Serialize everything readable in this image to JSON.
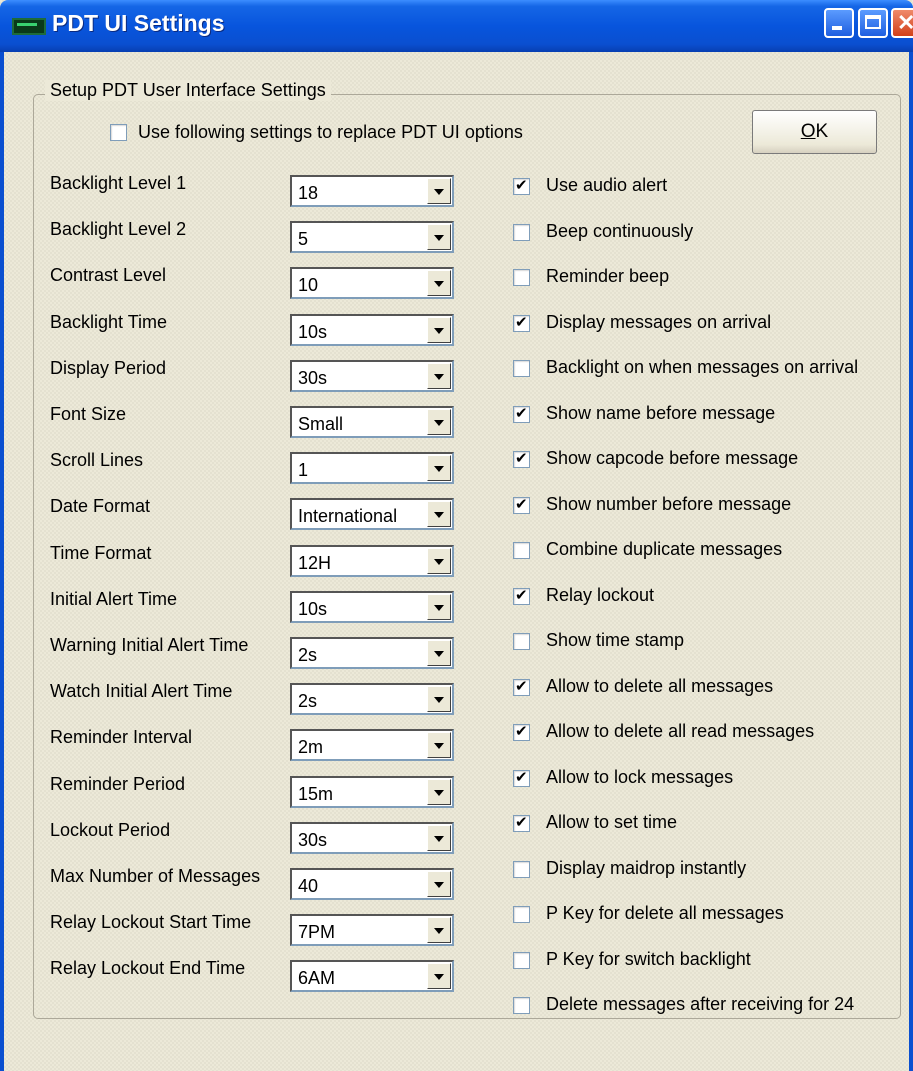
{
  "window": {
    "title": "PDT UI Settings",
    "icon": "pager-icon"
  },
  "group": {
    "label": "Setup PDT User Interface Settings",
    "replace_option": {
      "label": "Use following settings to replace PDT UI options",
      "checked": false
    },
    "ok_button": {
      "label_underlined": "O",
      "label_rest": "K"
    }
  },
  "settings": [
    {
      "label": "Backlight Level 1",
      "value": "18"
    },
    {
      "label": "Backlight Level 2",
      "value": "5"
    },
    {
      "label": "Contrast Level",
      "value": "10"
    },
    {
      "label": "Backlight Time",
      "value": "10s"
    },
    {
      "label": "Display Period",
      "value": "30s"
    },
    {
      "label": "Font Size",
      "value": "Small"
    },
    {
      "label": "Scroll Lines",
      "value": "1"
    },
    {
      "label": "Date Format",
      "value": "International"
    },
    {
      "label": "Time Format",
      "value": "12H"
    },
    {
      "label": "Initial Alert Time",
      "value": "10s"
    },
    {
      "label": "Warning Initial Alert Time",
      "value": "2s"
    },
    {
      "label": "Watch Initial Alert Time",
      "value": "2s"
    },
    {
      "label": "Reminder Interval",
      "value": "2m"
    },
    {
      "label": "Reminder Period",
      "value": "15m"
    },
    {
      "label": "Lockout Period",
      "value": "30s"
    },
    {
      "label": "Max Number of Messages",
      "value": "40"
    },
    {
      "label": "Relay Lockout Start Time",
      "value": "7PM"
    },
    {
      "label": "Relay Lockout End Time",
      "value": "6AM"
    }
  ],
  "options": [
    {
      "label": "Use audio alert",
      "checked": true
    },
    {
      "label": "Beep continuously",
      "checked": false
    },
    {
      "label": "Reminder beep",
      "checked": false
    },
    {
      "label": "Display messages on arrival",
      "checked": true
    },
    {
      "label": "Backlight on when messages on arrival",
      "checked": false
    },
    {
      "label": "Show name before message",
      "checked": true
    },
    {
      "label": "Show capcode before message",
      "checked": true
    },
    {
      "label": "Show number before message",
      "checked": true
    },
    {
      "label": "Combine duplicate messages",
      "checked": false
    },
    {
      "label": "Relay lockout",
      "checked": true
    },
    {
      "label": "Show time stamp",
      "checked": false
    },
    {
      "label": "Allow to delete all messages",
      "checked": true
    },
    {
      "label": "Allow to delete all read messages",
      "checked": true
    },
    {
      "label": "Allow to lock messages",
      "checked": true
    },
    {
      "label": "Allow to set time",
      "checked": true
    },
    {
      "label": "Display maidrop instantly",
      "checked": false
    },
    {
      "label": "P Key for delete all messages",
      "checked": false
    },
    {
      "label": "P Key for switch backlight",
      "checked": false
    },
    {
      "label": "Delete messages after receiving for 24",
      "checked": false
    }
  ]
}
